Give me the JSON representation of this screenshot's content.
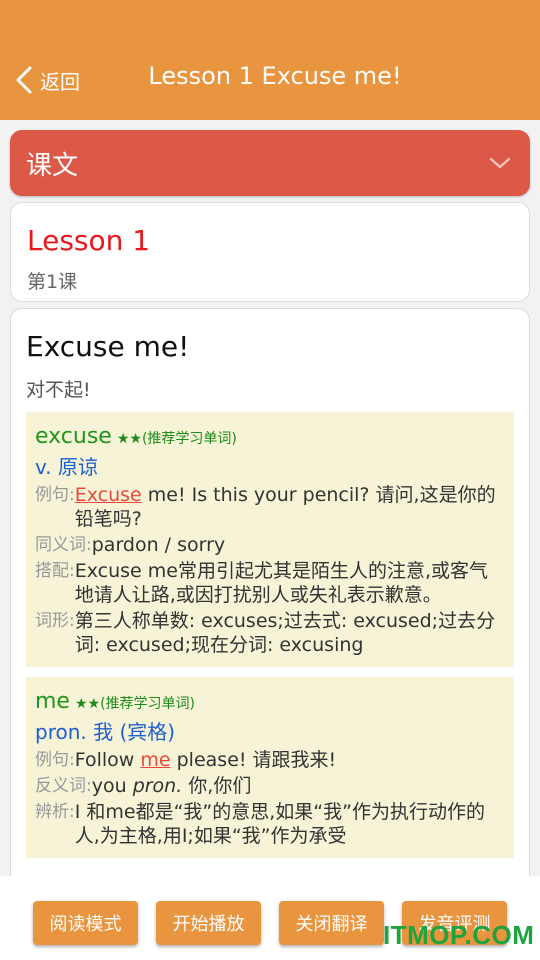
{
  "header": {
    "back_label": "返回",
    "title": "Lesson 1 Excuse me!",
    "accent_color": "#e9943e",
    "back_icon": "chevron-left-icon"
  },
  "section": {
    "title": "课文",
    "color": "#dc5947",
    "toggle_icon": "chevron-down-icon"
  },
  "lesson": {
    "title": "Lesson 1",
    "subtitle": "第1课"
  },
  "sentence": {
    "en": "Excuse me!",
    "cn": "对不起!",
    "words": [
      {
        "term": "excuse",
        "stars": "★★",
        "tag": "(推荐学习单词)",
        "pos": "v. 原谅",
        "example_label": "例句:",
        "example_hl": "Excuse",
        "example_rest": " me! Is this your pencil? 请问,这是你的铅笔吗?",
        "syn_label": "同义词:",
        "syn_text": "pardon / sorry",
        "coll_label": "搭配:",
        "coll_text": "Excuse me常用引起尤其是陌生人的注意,或客气地请人让路,或因打扰别人或失礼表示歉意。",
        "form_label": "词形:",
        "form_text": "第三人称单数: excuses;过去式: excused;过去分词: excused;现在分词: excusing"
      },
      {
        "term": "me",
        "stars": "★★",
        "tag": "(推荐学习单词)",
        "pos": "pron. 我 (宾格)",
        "example_label": "例句:",
        "example_pre": "Follow ",
        "example_hl": "me",
        "example_rest": " please! 请跟我来!",
        "ant_label": "反义词:",
        "ant_pre": "you ",
        "ant_it": "pron.",
        "ant_rest": " 你,你们",
        "diff_label": "辨析:",
        "diff_text": "I 和me都是“我”的意思,如果“我”作为执行动作的人,为主格,用I;如果“我”作为承受"
      }
    ]
  },
  "buttons": {
    "read_mode": "阅读模式",
    "start_play": "开始播放",
    "close_translation": "关闭翻译",
    "pronunciation_eval": "发音评测"
  },
  "watermark": "ITMOP.COM"
}
